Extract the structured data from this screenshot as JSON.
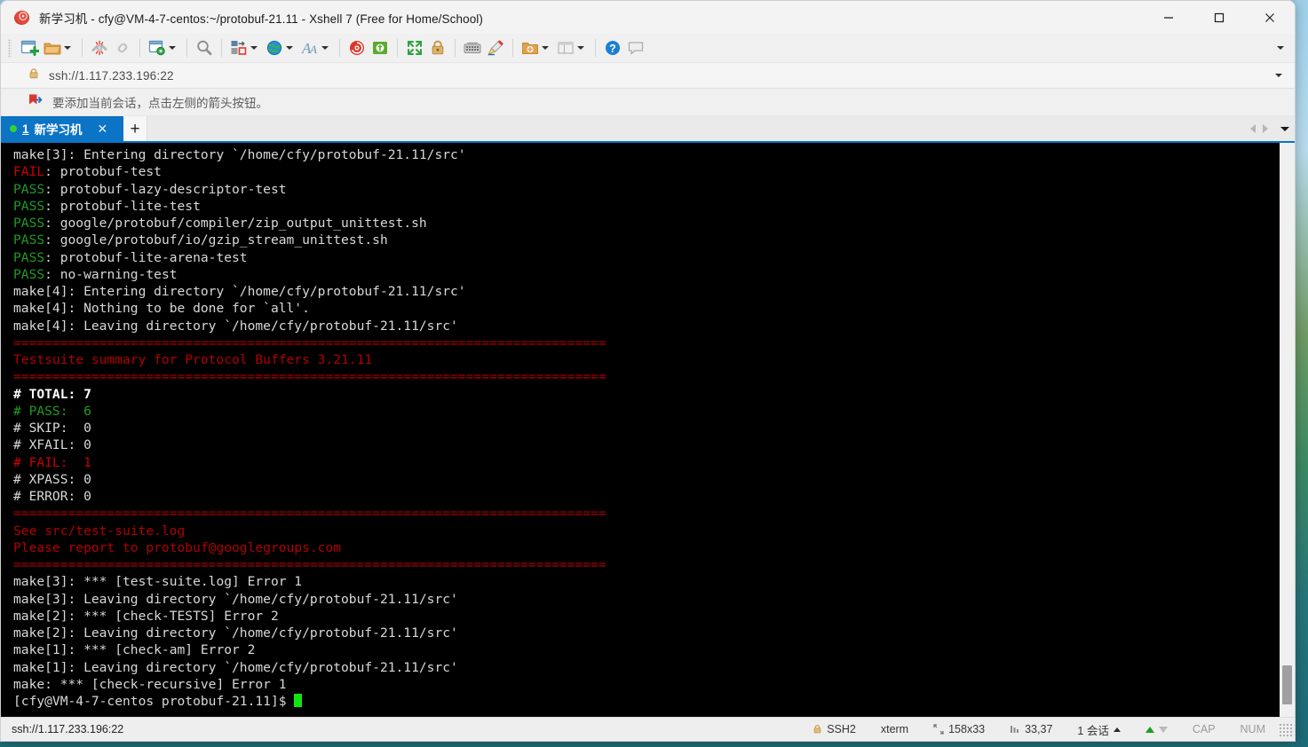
{
  "window": {
    "title": "新学习机 - cfy@VM-4-7-centos:~/protobuf-21.11 - Xshell 7 (Free for Home/School)",
    "app_icon": "xshell-spiral-icon",
    "minimize_label": "—",
    "maximize_label": "□",
    "close_label": "✕"
  },
  "toolbar": {
    "items": [
      {
        "name": "new-session-icon",
        "caret": false
      },
      {
        "name": "open-folder-icon",
        "caret": true
      },
      {
        "name": "disconnect-icon",
        "caret": false
      },
      {
        "name": "reconnect-icon",
        "caret": false
      },
      {
        "name": "session-properties-icon",
        "caret": true
      },
      {
        "name": "find-icon",
        "caret": false
      },
      {
        "name": "transfer-file-icon",
        "caret": true
      },
      {
        "name": "globe-icon",
        "caret": true
      },
      {
        "name": "font-icon",
        "caret": true
      },
      {
        "name": "xshell-icon",
        "caret": false
      },
      {
        "name": "ftp-icon",
        "caret": false
      },
      {
        "name": "fullscreen-icon",
        "caret": false
      },
      {
        "name": "lock-icon",
        "caret": false
      },
      {
        "name": "keyboard-icon",
        "caret": false
      },
      {
        "name": "highlight-icon",
        "caret": false
      },
      {
        "name": "new-folder-icon",
        "caret": true
      },
      {
        "name": "layout-icon",
        "caret": true
      },
      {
        "name": "help-icon",
        "caret": false
      },
      {
        "name": "chat-icon",
        "caret": false
      }
    ],
    "overflow_label": "▾"
  },
  "address_bar": {
    "lock_icon": "lock-icon",
    "value": "ssh://1.117.233.196:22",
    "placeholder": "ssh://1.117.233.196:22",
    "dropdown_label": "▾"
  },
  "notice_bar": {
    "icon": "bookmark-arrow-icon",
    "text": "要添加当前会话，点击左侧的箭头按钮。"
  },
  "tab_bar": {
    "tabs": [
      {
        "status_icon": "connected-dot",
        "number": "1",
        "label": "新学习机",
        "close_label": "✕",
        "active": true
      }
    ],
    "add_tab_label": "+",
    "nav_prev_label": "◀",
    "nav_next_label": "▶",
    "nav_menu_label": "▾"
  },
  "terminal": {
    "lines": [
      [
        {
          "t": "make[3]: Entering directory `/home/cfy/protobuf-21.11/src'",
          "c": "white"
        }
      ],
      [
        {
          "t": "FAIL",
          "c": "red"
        },
        {
          "t": ": protobuf-test",
          "c": "white"
        }
      ],
      [
        {
          "t": "PASS",
          "c": "green"
        },
        {
          "t": ": protobuf-lazy-descriptor-test",
          "c": "white"
        }
      ],
      [
        {
          "t": "PASS",
          "c": "green"
        },
        {
          "t": ": protobuf-lite-test",
          "c": "white"
        }
      ],
      [
        {
          "t": "PASS",
          "c": "green"
        },
        {
          "t": ": google/protobuf/compiler/zip_output_unittest.sh",
          "c": "white"
        }
      ],
      [
        {
          "t": "PASS",
          "c": "green"
        },
        {
          "t": ": google/protobuf/io/gzip_stream_unittest.sh",
          "c": "white"
        }
      ],
      [
        {
          "t": "PASS",
          "c": "green"
        },
        {
          "t": ": protobuf-lite-arena-test",
          "c": "white"
        }
      ],
      [
        {
          "t": "PASS",
          "c": "green"
        },
        {
          "t": ": no-warning-test",
          "c": "white"
        }
      ],
      [
        {
          "t": "make[4]: Entering directory `/home/cfy/protobuf-21.11/src'",
          "c": "white"
        }
      ],
      [
        {
          "t": "make[4]: Nothing to be done for `all'.",
          "c": "white"
        }
      ],
      [
        {
          "t": "make[4]: Leaving directory `/home/cfy/protobuf-21.11/src'",
          "c": "white"
        }
      ],
      [
        {
          "t": "============================================================================",
          "c": "dred"
        }
      ],
      [
        {
          "t": "Testsuite summary for Protocol Buffers 3.21.11",
          "c": "dred"
        }
      ],
      [
        {
          "t": "============================================================================",
          "c": "dred"
        }
      ],
      [
        {
          "t": "# TOTAL: 7",
          "c": "bold"
        }
      ],
      [
        {
          "t": "# PASS:  6",
          "c": "green"
        }
      ],
      [
        {
          "t": "# SKIP:  0",
          "c": "white"
        }
      ],
      [
        {
          "t": "# XFAIL: 0",
          "c": "white"
        }
      ],
      [
        {
          "t": "# FAIL:  1",
          "c": "red"
        }
      ],
      [
        {
          "t": "# XPASS: 0",
          "c": "white"
        }
      ],
      [
        {
          "t": "# ERROR: 0",
          "c": "white"
        }
      ],
      [
        {
          "t": "============================================================================",
          "c": "dred"
        }
      ],
      [
        {
          "t": "See src/test-suite.log",
          "c": "dred"
        }
      ],
      [
        {
          "t": "Please report to protobuf@googlegroups.com",
          "c": "dred"
        }
      ],
      [
        {
          "t": "============================================================================",
          "c": "dred"
        }
      ],
      [
        {
          "t": "make[3]: *** [test-suite.log] Error 1",
          "c": "white"
        }
      ],
      [
        {
          "t": "make[3]: Leaving directory `/home/cfy/protobuf-21.11/src'",
          "c": "white"
        }
      ],
      [
        {
          "t": "make[2]: *** [check-TESTS] Error 2",
          "c": "white"
        }
      ],
      [
        {
          "t": "make[2]: Leaving directory `/home/cfy/protobuf-21.11/src'",
          "c": "white"
        }
      ],
      [
        {
          "t": "make[1]: *** [check-am] Error 2",
          "c": "white"
        }
      ],
      [
        {
          "t": "make[1]: Leaving directory `/home/cfy/protobuf-21.11/src'",
          "c": "white"
        }
      ],
      [
        {
          "t": "make: *** [check-recursive] Error 1",
          "c": "white"
        }
      ],
      [
        {
          "t": "[cfy@VM-4-7-centos protobuf-21.11]$ ",
          "c": "white",
          "cursor": true
        }
      ]
    ],
    "colors": {
      "background": "#000000",
      "foreground": "#d8d8d8",
      "green": "#1f9b22",
      "red": "#cc0000",
      "dark_red": "#b20000",
      "bold_white": "#ffffff",
      "cursor": "#12e412"
    }
  },
  "status_bar": {
    "url": "ssh://1.117.233.196:22",
    "protocol_icon": "lock-icon",
    "protocol": "SSH2",
    "terminal_type": "xterm",
    "size_icon": "screen-size-icon",
    "size": "158x33",
    "cursor_icon": "cursor-pos-icon",
    "cursor_pos": "33,37",
    "sessions": "1 会话",
    "sessions_caret": "▲",
    "upload_icon": "upload-arrow-icon",
    "download_icon": "download-arrow-icon",
    "caps": "CAP",
    "num": "NUM",
    "resize_grip": "resize-grip-icon"
  }
}
